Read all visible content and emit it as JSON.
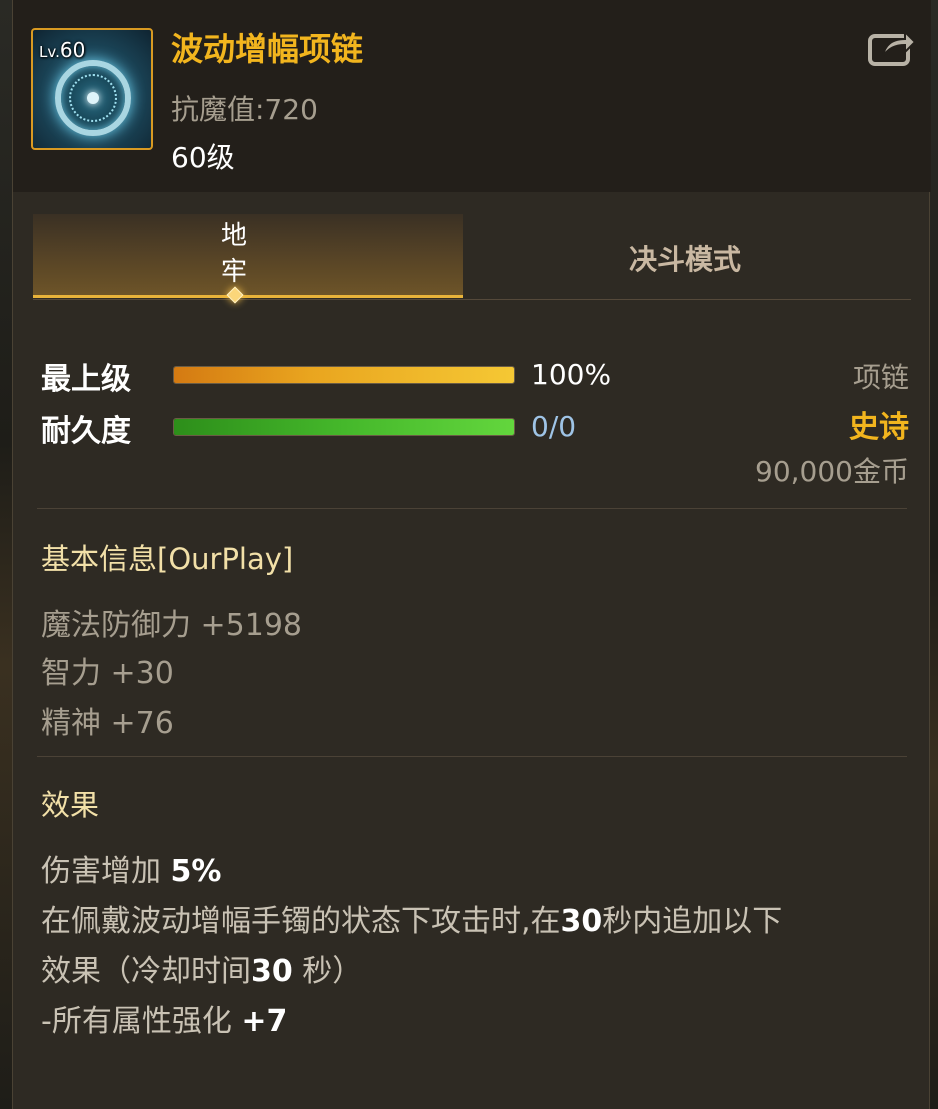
{
  "item": {
    "name": "波动增幅项链",
    "level_badge_prefix": "Lv.",
    "level_badge_num": "60",
    "resistance": "抗魔值:720",
    "level_text": "60级",
    "icon": "necklace-icon"
  },
  "tabs": [
    {
      "label": "地\n牢",
      "active": true
    },
    {
      "label": "决斗模式",
      "active": false
    }
  ],
  "stats": {
    "grade_label": "最上级",
    "grade_value": "100%",
    "grade_fraction": 1.0,
    "durability_label": "耐久度",
    "durability_value": "0/0",
    "durability_fraction": 1.0
  },
  "meta": {
    "type": "项链",
    "rarity": "史诗",
    "price": "90,000金币"
  },
  "basic_info": {
    "title": "基本信息[OurPlay]",
    "lines": [
      "魔法防御力 +5198",
      "智力 +30",
      "精神 +76"
    ]
  },
  "effects": {
    "title": "效果",
    "line1_a": "伤害增加 ",
    "line1_b": "5%",
    "line2_a": "在佩戴波动增幅手镯的状态下攻击时,在",
    "line2_b": "30",
    "line2_c": "秒内追加以下",
    "line3_a": "效果（冷却时间",
    "line3_b": "30",
    "line3_c": " 秒）",
    "line4_a": "-所有属性强化 ",
    "line4_b": "+7"
  },
  "colors": {
    "name_gold": "#f2b51e",
    "rarity_gold": "#f2b51e",
    "bar_orange": "#e9a51f",
    "bar_green": "#45b82b",
    "durability_blue": "#9fc4e6"
  }
}
